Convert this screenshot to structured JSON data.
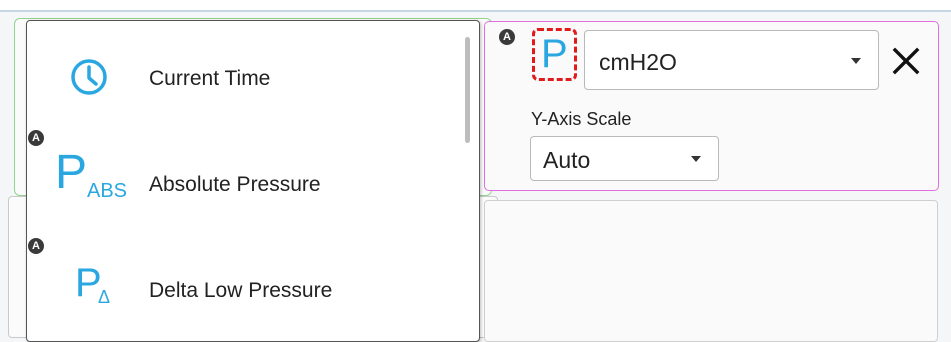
{
  "list": {
    "items": [
      {
        "label": "Current Time",
        "icon": "clock-icon"
      },
      {
        "label": "Absolute Pressure",
        "icon": "pressure-abs-icon",
        "symbol": "P",
        "subscript": "ABS",
        "badge": "A"
      },
      {
        "label": "Delta Low Pressure",
        "icon": "pressure-delta-icon",
        "symbol": "P",
        "subscript": "Δ",
        "badge": "A"
      }
    ]
  },
  "channel": {
    "badge": "A",
    "symbol": "P",
    "unit": "cmH2O",
    "y_axis_label": "Y-Axis Scale",
    "y_axis_scale": "Auto"
  },
  "colors": {
    "accent": "#2aa7e0",
    "selected_border": "#df6fe0",
    "highlight": "#e11a1a",
    "green_border": "#8fd48f"
  }
}
